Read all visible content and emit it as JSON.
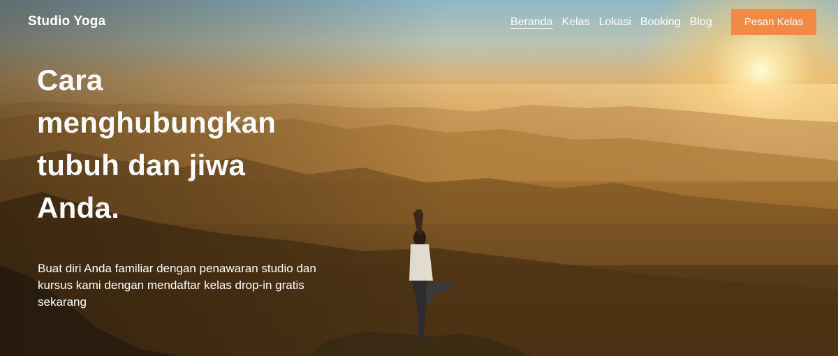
{
  "brand": {
    "name": "Studio Yoga"
  },
  "nav": {
    "items": [
      {
        "label": "Beranda",
        "active": true
      },
      {
        "label": "Kelas",
        "active": false
      },
      {
        "label": "Lokasi",
        "active": false
      },
      {
        "label": "Booking",
        "active": false
      },
      {
        "label": "Blog",
        "active": false
      }
    ],
    "cta_label": "Pesan Kelas"
  },
  "hero": {
    "headline": "Cara menghubungkan tubuh dan jiwa Anda.",
    "subtext": "Buat diri Anda familiar dengan penawaran studio dan kursus kami dengan mendaftar kelas drop-in gratis sekarang"
  },
  "colors": {
    "accent": "#f08a45",
    "text": "#ffffff"
  }
}
